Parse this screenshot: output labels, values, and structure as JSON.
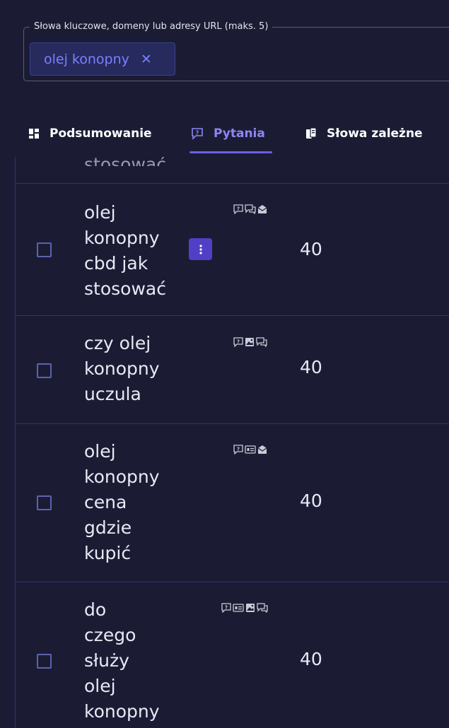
{
  "keywords_field": {
    "legend": "Słowa kluczowe, domeny lub adresy URL (maks. 5)",
    "chips": [
      {
        "label": "olej konopny",
        "remove_icon": "close-icon"
      }
    ]
  },
  "tabs": [
    {
      "label": "Podsumowanie",
      "icon": "dashboard-icon",
      "active": false
    },
    {
      "label": "Pytania",
      "icon": "question-bubble-icon",
      "active": true
    },
    {
      "label": "Słowa zależne",
      "icon": "related-words-icon",
      "active": false
    }
  ],
  "colors": {
    "accent": "#6b5fe0",
    "background": "#1b1c34",
    "border": "#2f3270",
    "chip": "#7b80ff"
  },
  "rows": [
    {
      "keyword_partial": "stosować"
    },
    {
      "keyword": [
        "olej",
        "konopny",
        "cbd jak",
        "stosować"
      ],
      "volume": "40",
      "features": [
        "question-icon",
        "chat-icon",
        "mail-icon"
      ],
      "has_menu": true
    },
    {
      "keyword": [
        "czy olej",
        "konopny",
        "uczula"
      ],
      "volume": "40",
      "features": [
        "question-icon",
        "image-icon",
        "chat-icon"
      ]
    },
    {
      "keyword": [
        "olej",
        "konopny",
        "cena",
        "gdzie",
        "kupić"
      ],
      "volume": "40",
      "features": [
        "question-icon",
        "list-icon",
        "mail-icon"
      ]
    },
    {
      "keyword": [
        "do",
        "czego",
        "służy",
        "olej",
        "konopny"
      ],
      "volume": "40",
      "features": [
        "question-icon",
        "list-icon",
        "image-icon",
        "chat-icon"
      ]
    }
  ]
}
